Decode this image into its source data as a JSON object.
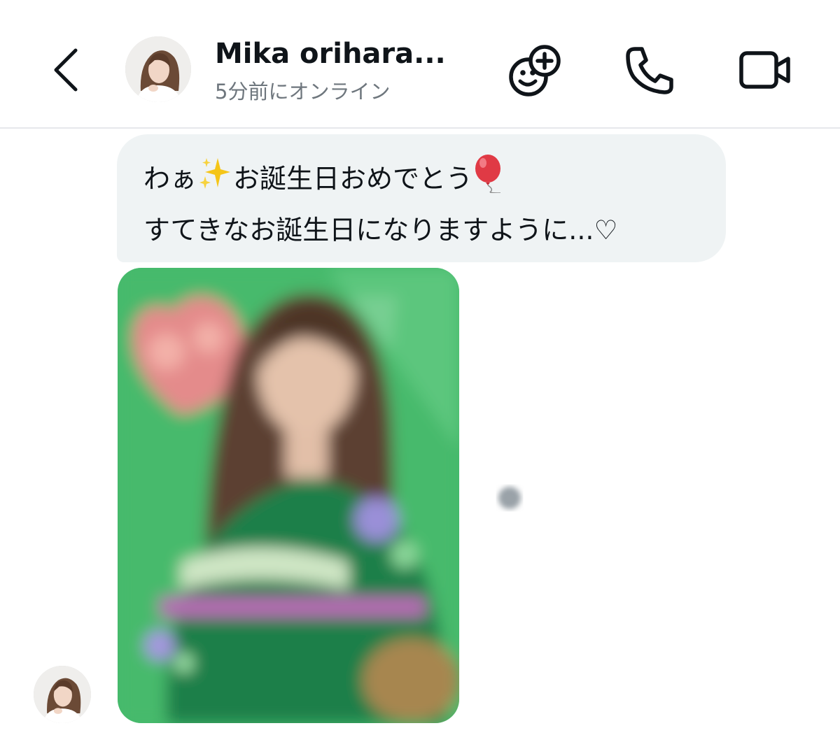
{
  "header": {
    "contact_name": "Mika orihara...",
    "status": "5分前にオンライン",
    "back_icon": "chevron-left-icon",
    "actions": {
      "games_icon": "game-controller-add-icon",
      "call_icon": "phone-icon",
      "video_icon": "video-camera-icon"
    }
  },
  "conversation": {
    "message": {
      "line1_prefix": "わぁ",
      "line1_middle": "お誕生日おめでとう",
      "line2": "すてきなお誕生日になりますように...♡",
      "emojis": [
        "sparkles-emoji",
        "balloon-emoji"
      ]
    },
    "image_message": {
      "state": "blurred"
    }
  },
  "colors": {
    "text_primary": "#0f1419",
    "text_secondary": "#6e767d",
    "bubble_background": "#eff3f4",
    "divider": "#e6e8eb",
    "image_green": "#3fb86a"
  }
}
